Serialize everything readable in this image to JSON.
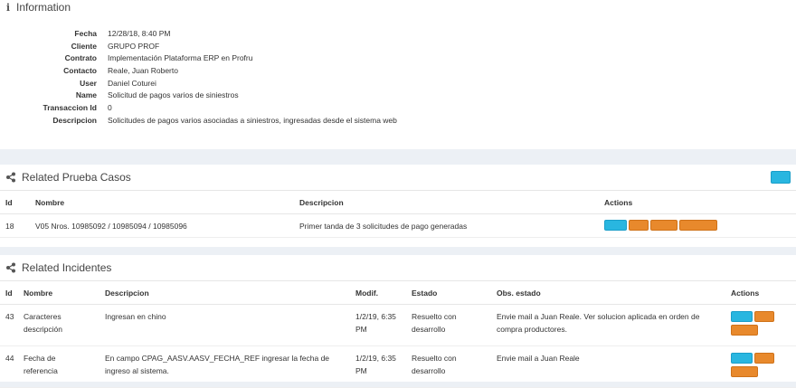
{
  "info": {
    "title": "Information",
    "rows": [
      {
        "key": "Fecha",
        "value": "12/28/18, 8:40 PM"
      },
      {
        "key": "Cliente",
        "value": "GRUPO PROF"
      },
      {
        "key": "Contrato",
        "value": "Implementación Plataforma ERP en Profru"
      },
      {
        "key": "Contacto",
        "value": "Reale, Juan Roberto"
      },
      {
        "key": "User",
        "value": "Daniel Coturei"
      },
      {
        "key": "Name",
        "value": "Solicitud de pagos varios de siniestros"
      },
      {
        "key": "Transaccion Id",
        "value": "0"
      },
      {
        "key": "Descripcion",
        "value": "Solicitudes de pagos varios asociadas a siniestros, ingresadas desde el sistema web"
      }
    ]
  },
  "casos": {
    "title": "Related Prueba Casos",
    "headers": {
      "id": "Id",
      "nombre": "Nombre",
      "descripcion": "Descripcion",
      "actions": "Actions"
    },
    "rows": [
      {
        "id": "18",
        "nombre": "V05 Nros. 10985092 / 10985094 / 10985096",
        "descripcion": "Primer tanda de 3 solicitudes de pago generadas"
      }
    ]
  },
  "incidentes": {
    "title": "Related Incidentes",
    "headers": {
      "id": "Id",
      "nombre": "Nombre",
      "descripcion": "Descripcion",
      "modif": "Modif.",
      "estado": "Estado",
      "obs": "Obs. estado",
      "actions": "Actions"
    },
    "rows": [
      {
        "id": "43",
        "nombre": "Caracteres descripción",
        "descripcion": "Ingresan en chino",
        "modif": "1/2/19, 6:35 PM",
        "estado": "Resuelto con desarrollo",
        "obs": "Envie mail a Juan Reale. Ver solucion aplicada en orden de compra productores."
      },
      {
        "id": "44",
        "nombre": "Fecha de referencia",
        "descripcion": "En campo CPAG_AASV.AASV_FECHA_REF ingresar la fecha de ingreso al sistema.",
        "modif": "1/2/19, 6:35 PM",
        "estado": "Resuelto con desarrollo",
        "obs": "Envie mail a Juan Reale"
      }
    ]
  },
  "colors": {
    "blue_button": "#29b6e0",
    "orange_button": "#e8892c",
    "background": "#ecf0f5"
  }
}
